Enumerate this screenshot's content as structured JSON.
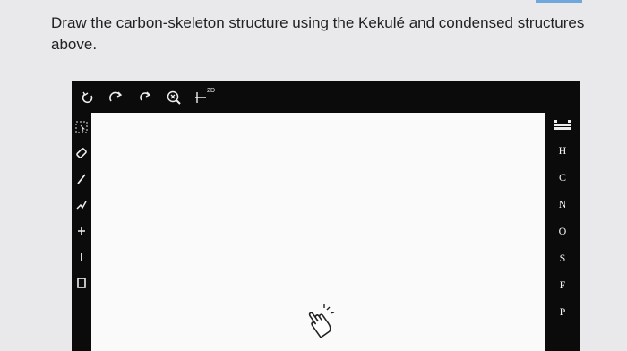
{
  "question": {
    "text": "Draw the carbon-skeleton structure using the Kekulé and condensed structures above."
  },
  "editor": {
    "top_tools": [
      "undo-icon",
      "redo-icon",
      "reset-icon",
      "zoom-icon",
      "2d-cleanup-icon"
    ],
    "top_tool_badge": "2D",
    "left_tools": [
      "selection-icon",
      "eraser-icon",
      "single-bond-icon",
      "chain-icon",
      "charge-plus-icon",
      "charge-minus-icon",
      "bracket-icon"
    ],
    "elements": [
      "H",
      "C",
      "N",
      "O",
      "S",
      "F",
      "P"
    ]
  },
  "colors": {
    "toolbar": "#0b0b0b",
    "canvas": "#fafafa",
    "accent": "#6fa8dc"
  }
}
